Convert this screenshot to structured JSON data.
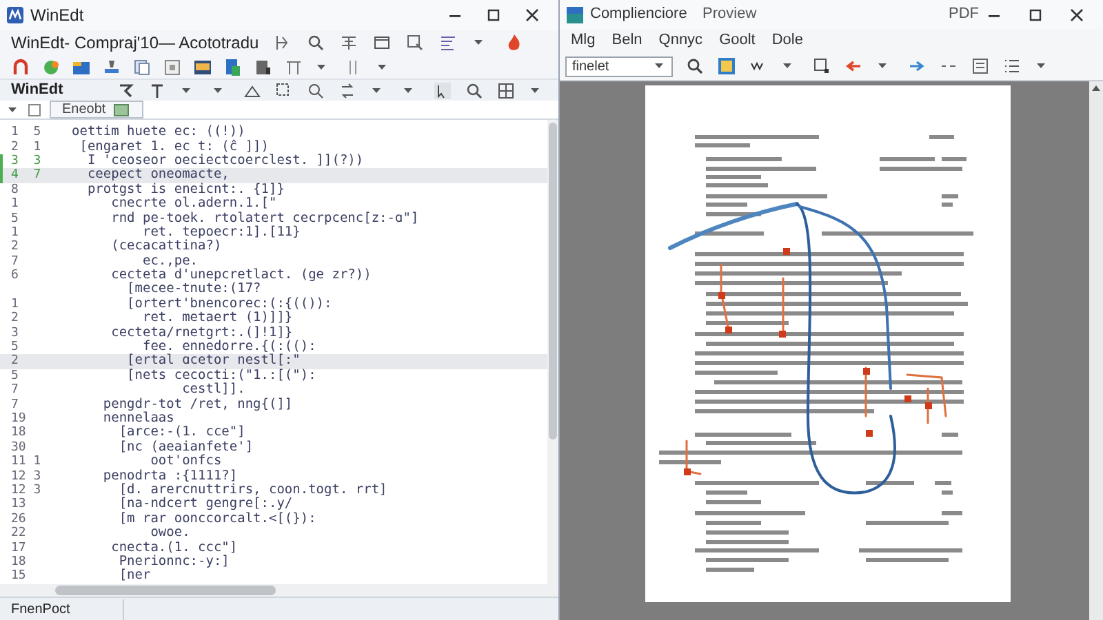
{
  "editor_window": {
    "title": "WinEdt",
    "document_line": "WinEdt- Compraj'10— Acototradu",
    "toolbar_label": "WinEdt",
    "tab": {
      "label": "Eneobt",
      "selected": true
    },
    "lines": [
      {
        "number": "1  5",
        "code": "oettim huete ec: ((!))",
        "highlighted": false,
        "modified": false
      },
      {
        "number": "2  1",
        "code": " [engaret 1. ec t: (ĉ ]])",
        "highlighted": false,
        "modified": false
      },
      {
        "number": "3  3",
        "code": "  I 'ceoseor oeciectcoerclest. ]](?))",
        "highlighted": false,
        "modified": true
      },
      {
        "number": "4  7",
        "code": "  ceepect oneomacte,",
        "highlighted": true,
        "modified": true
      },
      {
        "number": "8",
        "code": "  protgst is eneicnt:. {1]}",
        "highlighted": false,
        "modified": false
      },
      {
        "number": "1",
        "code": "     cnecrte ol.adern.1.[\"",
        "highlighted": false,
        "modified": false
      },
      {
        "number": "5",
        "code": "     rnd pe-toek. rtolatert cecrpcenc[z:-ɑ\"]",
        "highlighted": false,
        "modified": false
      },
      {
        "number": "1",
        "code": "         ret. tepoecr:1].[11}",
        "highlighted": false,
        "modified": false
      },
      {
        "number": "2",
        "code": "     (cecacattina?)",
        "highlighted": false,
        "modified": false
      },
      {
        "number": "7",
        "code": "         ec.,pe.",
        "highlighted": false,
        "modified": false
      },
      {
        "number": "6",
        "code": "     cecteta d'unepcretlact. (ge zr?))",
        "highlighted": false,
        "modified": false
      },
      {
        "code": "       [mecee-tnute:(17?",
        "highlighted": false,
        "modified": false
      },
      {
        "number": "1",
        "code": "       [ortert'bnencorec:(:{(()):",
        "highlighted": false,
        "modified": false
      },
      {
        "number": "2",
        "code": "         ret. metaert (1)]]}",
        "highlighted": false,
        "modified": false
      },
      {
        "number": "3",
        "code": "     cecteta/rnetgrt:.(]!1]}",
        "highlighted": false,
        "modified": false
      },
      {
        "number": "5",
        "code": "         fee. ennedorre.{(:(():",
        "highlighted": false,
        "modified": false
      },
      {
        "number": "2",
        "code": "       [ertal ɑcetor nestl[:\"",
        "highlighted": true,
        "modified": false
      },
      {
        "number": "5",
        "code": "       [nets cecocti:(\"1.:[(\"):",
        "highlighted": false,
        "modified": false
      },
      {
        "number": "7",
        "code": "              cestl]].",
        "highlighted": false,
        "modified": false
      },
      {
        "number": "7",
        "code": "    pengdr-tot /ret, nng{(]]",
        "highlighted": false,
        "modified": false
      },
      {
        "number": "19",
        "code": "    nennelaas",
        "highlighted": false,
        "modified": false
      },
      {
        "number": "18",
        "code": "      [arce:-(1. cce\"]",
        "highlighted": false,
        "modified": false
      },
      {
        "number": "30",
        "code": "      [nc (aeaianfete']",
        "highlighted": false,
        "modified": false
      },
      {
        "number": "11 1",
        "code": "          oot'onfcs",
        "highlighted": false,
        "modified": false
      },
      {
        "number": "12 3",
        "code": "    penodrta :{1111?]",
        "highlighted": false,
        "modified": false
      },
      {
        "number": "12 3",
        "code": "      [d. arercnuttrirs, coon.togt. rrt]",
        "highlighted": false,
        "modified": false
      },
      {
        "number": "13",
        "code": "      [na-ndcert gengre[:.y/",
        "highlighted": false,
        "modified": false
      },
      {
        "number": "26",
        "code": "      [m rar oonccorcalt.<[(}):",
        "highlighted": false,
        "modified": false
      },
      {
        "number": "22",
        "code": "          owoe.",
        "highlighted": false,
        "modified": false
      },
      {
        "number": "17",
        "code": "     cnecta.(1. ccc\"]",
        "highlighted": false,
        "modified": false
      },
      {
        "number": "18",
        "code": "      Pnerionnc:-y:]",
        "highlighted": false,
        "modified": false
      },
      {
        "number": "15",
        "code": "      [ner",
        "highlighted": false,
        "modified": false
      }
    ],
    "status_bar": "FnenPoct"
  },
  "preview_window": {
    "title": "Complienciore",
    "subtitle": "Proview",
    "center_title": "PDF",
    "menu": [
      "Mlg",
      "Beln",
      "Qnnyc",
      "Goolt",
      "Dole"
    ],
    "zoom_field": {
      "value": "finelet"
    }
  }
}
